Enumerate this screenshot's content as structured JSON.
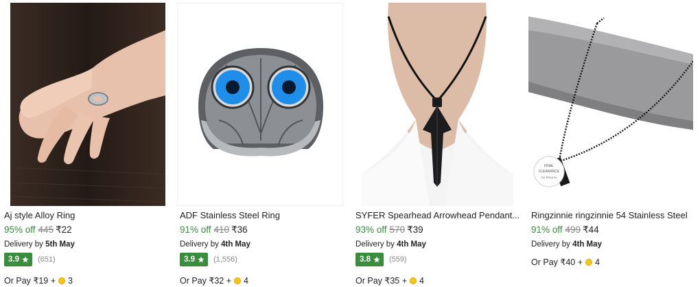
{
  "products": [
    {
      "title": "Aj style Alloy Ring",
      "discount": "95% off",
      "mrp": "445",
      "price": "₹22",
      "delivery_prefix": "Delivery by",
      "delivery_date": "5th May",
      "rating": "3.9",
      "rating_count": "(651)",
      "pay_prefix": "Or Pay ₹19 +",
      "coins": "3",
      "image_icon": "hand-with-ring-photo"
    },
    {
      "title": "ADF Stainless Steel Ring",
      "discount": "91% off",
      "mrp": "410",
      "price": "₹36",
      "delivery_prefix": "Delivery by",
      "delivery_date": "4th May",
      "rating": "3.9",
      "rating_count": "(1,556)",
      "pay_prefix": "Or Pay ₹32 +",
      "coins": "4",
      "image_icon": "owl-ring-photo"
    },
    {
      "title": "SYFER Spearhead Arrowhead Pendant...",
      "discount": "93% off",
      "mrp": "570",
      "price": "₹39",
      "delivery_prefix": "Delivery by",
      "delivery_date": "4th May",
      "rating": "3.8",
      "rating_count": "(559)",
      "pay_prefix": "Or Pay ₹35 +",
      "coins": "4",
      "image_icon": "arrowhead-pendant-photo"
    },
    {
      "title": "Ringzinnie ringzinnie 54 Stainless Steel",
      "discount": "91% off",
      "mrp": "499",
      "price": "₹44",
      "delivery_prefix": "Delivery by",
      "delivery_date": "4th May",
      "pay_prefix": "Or Pay ₹40 +",
      "coins": "4",
      "image_icon": "ball-chain-necklace-photo",
      "tag_line1": "FINAL",
      "tag_line2": "CLEARANCE",
      "tag_line3": "No Returns"
    }
  ],
  "colors": {
    "discount_green": "#388e3c",
    "rating_badge": "#388e3c",
    "muted_gray": "#878787",
    "coin_gold": "#f5c518"
  }
}
